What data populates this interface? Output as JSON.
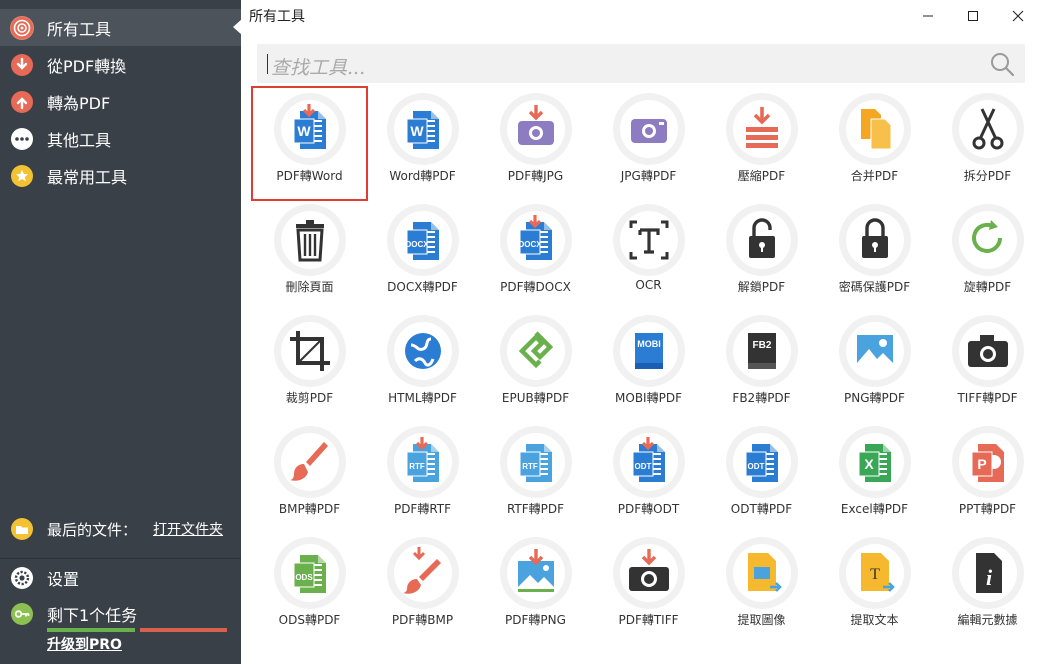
{
  "colors": {
    "sidebar_bg": "#3a4048",
    "sidebar_active": "#4c535b",
    "highlight": "#e03c31",
    "progress_done": "#6ab04c",
    "progress_left": "#d9604c"
  },
  "sidebar": {
    "items": [
      {
        "label": "所有工具",
        "icon": "target-icon",
        "active": true
      },
      {
        "label": "從PDF轉換",
        "icon": "arrow-down-icon"
      },
      {
        "label": "轉為PDF",
        "icon": "arrow-up-icon"
      },
      {
        "label": "其他工具",
        "icon": "more-icon"
      },
      {
        "label": "最常用工具",
        "icon": "star-icon"
      }
    ],
    "recent": {
      "label": "最后的文件：",
      "link": "打开文件夹",
      "icon": "folder-icon"
    },
    "settings": {
      "label": "设置",
      "icon": "gear-icon"
    },
    "tasks": {
      "label": "剩下1个任务",
      "icon": "key-icon",
      "progress": 0.5
    },
    "upgrade": "升级到PRO"
  },
  "window": {
    "title": "所有工具"
  },
  "search": {
    "placeholder": "查找工具..."
  },
  "tools": [
    {
      "label": "PDF轉Word",
      "icon": "pdf-to-word-icon",
      "selected": true
    },
    {
      "label": "Word轉PDF",
      "icon": "word-icon"
    },
    {
      "label": "PDF轉JPG",
      "icon": "pdf-to-jpg-icon"
    },
    {
      "label": "JPG轉PDF",
      "icon": "jpg-icon"
    },
    {
      "label": "壓縮PDF",
      "icon": "compress-icon"
    },
    {
      "label": "合并PDF",
      "icon": "merge-icon"
    },
    {
      "label": "拆分PDF",
      "icon": "scissors-icon"
    },
    {
      "label": "刪除頁面",
      "icon": "trash-icon"
    },
    {
      "label": "DOCX轉PDF",
      "icon": "docx-icon"
    },
    {
      "label": "PDF轉DOCX",
      "icon": "pdf-to-docx-icon"
    },
    {
      "label": "OCR",
      "icon": "ocr-icon"
    },
    {
      "label": "解鎖PDF",
      "icon": "unlock-icon"
    },
    {
      "label": "密碼保護PDF",
      "icon": "lock-icon"
    },
    {
      "label": "旋轉PDF",
      "icon": "rotate-icon"
    },
    {
      "label": "裁剪PDF",
      "icon": "crop-icon"
    },
    {
      "label": "HTML轉PDF",
      "icon": "globe-icon"
    },
    {
      "label": "EPUB轉PDF",
      "icon": "epub-icon"
    },
    {
      "label": "MOBI轉PDF",
      "icon": "mobi-icon"
    },
    {
      "label": "FB2轉PDF",
      "icon": "fb2-icon"
    },
    {
      "label": "PNG轉PDF",
      "icon": "png-icon"
    },
    {
      "label": "TIFF轉PDF",
      "icon": "camera-icon"
    },
    {
      "label": "BMP轉PDF",
      "icon": "brush-icon"
    },
    {
      "label": "PDF轉RTF",
      "icon": "pdf-to-rtf-icon"
    },
    {
      "label": "RTF轉PDF",
      "icon": "rtf-icon"
    },
    {
      "label": "PDF轉ODT",
      "icon": "pdf-to-odt-icon"
    },
    {
      "label": "ODT轉PDF",
      "icon": "odt-icon"
    },
    {
      "label": "Excel轉PDF",
      "icon": "excel-icon"
    },
    {
      "label": "PPT轉PDF",
      "icon": "ppt-icon"
    },
    {
      "label": "ODS轉PDF",
      "icon": "ods-icon"
    },
    {
      "label": "PDF轉BMP",
      "icon": "pdf-to-bmp-icon"
    },
    {
      "label": "PDF轉PNG",
      "icon": "pdf-to-png-icon"
    },
    {
      "label": "PDF轉TIFF",
      "icon": "pdf-to-tiff-icon"
    },
    {
      "label": "提取圖像",
      "icon": "extract-image-icon"
    },
    {
      "label": "提取文本",
      "icon": "extract-text-icon"
    },
    {
      "label": "編輯元數據",
      "icon": "info-icon"
    }
  ]
}
